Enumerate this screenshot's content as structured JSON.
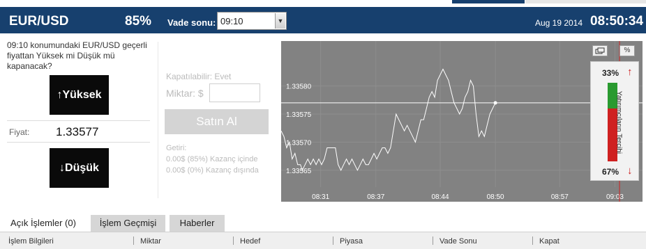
{
  "header": {
    "pair": "EUR/USD",
    "payout": "85%",
    "expiry_label": "Vade sonu:",
    "expiry_value": "09:10",
    "date": "Aug 19 2014",
    "time": "08:50:34"
  },
  "trade": {
    "question": "09:10 konumundaki EUR/USD geçerli fiyattan Yüksek mi Düşük mü kapanacak?",
    "high_label": "↑Yüksek",
    "low_label": "↓Düşük",
    "price_label": "Fiyat:",
    "price_value": "1.33577"
  },
  "order": {
    "closable": "Kapatılabilir: Evet",
    "amount_label": "Miktar: $",
    "amount_value": "",
    "buy_label": "Satın Al",
    "return_title": "Getiri:",
    "return_in": "0.00$ (85%) Kazanç içinde",
    "return_out": "0.00$ (0%) Kazanç dışında"
  },
  "chart_controls": {
    "window_icon": "window-icon",
    "percent_label": "%"
  },
  "preference": {
    "up_pct": "33%",
    "down_pct": "67%",
    "up_fraction": 0.33,
    "label": "Yatırımcıların Tercihi"
  },
  "chart_data": {
    "type": "line",
    "ylim": [
      1.33562,
      1.33588
    ],
    "y_ticks": [
      "1.33580",
      "1.33575",
      "1.33570",
      "1.33565"
    ],
    "y_tick_values": [
      1.3358,
      1.33575,
      1.3357,
      1.33565
    ],
    "x_ticks": [
      "08:31",
      "08:37",
      "08:44",
      "08:50",
      "08:57",
      "09:03"
    ],
    "x_tick_minutes": [
      31.0,
      37.0,
      44.0,
      50.0,
      57.0,
      63.0
    ],
    "xlim_minutes": [
      26.7,
      66.0
    ],
    "current_price": 1.33577,
    "expiry_marker_minute": 63.5,
    "series": [
      {
        "x": [
          26.7,
          27.0,
          27.3,
          27.6,
          27.9,
          28.2,
          28.5,
          28.8,
          29.0,
          29.3,
          29.6,
          29.9,
          30.2,
          30.5,
          30.8,
          31.1,
          31.4,
          31.7,
          32.0,
          32.3,
          32.6,
          32.9,
          33.2,
          33.5,
          33.8,
          34.1,
          34.4,
          34.7,
          35.0,
          35.3,
          35.6,
          35.9,
          36.2,
          36.5,
          36.8,
          37.1,
          37.4,
          37.7,
          38.0,
          38.3,
          38.6,
          38.9,
          39.2,
          39.5,
          39.8,
          40.1,
          40.4,
          40.7,
          41.0,
          41.3,
          41.6,
          41.9,
          42.2,
          42.5,
          42.8,
          43.1,
          43.4,
          43.7,
          44.0,
          44.3,
          44.6,
          44.9,
          45.2,
          45.5,
          45.8,
          46.1,
          46.4,
          46.7,
          47.0,
          47.3,
          47.6,
          47.9,
          48.2,
          48.5,
          48.8,
          49.1,
          49.4,
          49.7,
          50.0
        ],
        "values": [
          1.33572,
          1.33571,
          1.33569,
          1.3357,
          1.33567,
          1.33568,
          1.33566,
          1.33566,
          1.33565,
          1.33566,
          1.33567,
          1.33566,
          1.33567,
          1.33566,
          1.33567,
          1.33566,
          1.33567,
          1.33569,
          1.33569,
          1.33569,
          1.33569,
          1.33566,
          1.33565,
          1.33566,
          1.33567,
          1.33566,
          1.33567,
          1.33566,
          1.33565,
          1.33566,
          1.33567,
          1.33566,
          1.33566,
          1.33567,
          1.33568,
          1.33567,
          1.33568,
          1.33569,
          1.33569,
          1.33568,
          1.33569,
          1.33572,
          1.33575,
          1.33574,
          1.33573,
          1.33572,
          1.33573,
          1.33572,
          1.33571,
          1.3357,
          1.33572,
          1.33574,
          1.33574,
          1.33576,
          1.33578,
          1.33579,
          1.33578,
          1.33581,
          1.33582,
          1.33583,
          1.33582,
          1.33581,
          1.33579,
          1.33577,
          1.33576,
          1.33575,
          1.33576,
          1.33578,
          1.33579,
          1.33581,
          1.3358,
          1.33575,
          1.33571,
          1.33572,
          1.33571,
          1.33573,
          1.33575,
          1.33576,
          1.33577
        ]
      }
    ]
  },
  "tabs": [
    {
      "label": "Açık İşlemler (0)"
    },
    {
      "label": "İşlem Geçmişi"
    },
    {
      "label": "Haberler"
    }
  ],
  "table": {
    "columns": [
      "İşlem Bilgileri",
      "Miktar",
      "Hedef",
      "Piyasa",
      "Vade Sonu",
      "Kapat"
    ]
  },
  "colors": {
    "header_bg": "#17406e",
    "chart_bg": "#828282",
    "up_green": "#2a9a30",
    "down_red": "#cf2020"
  }
}
